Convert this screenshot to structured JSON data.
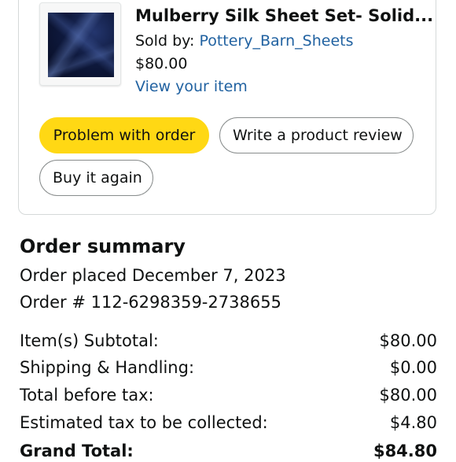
{
  "item": {
    "title": "Mulberry Silk Sheet Set- Solid...",
    "sold_by_label": "Sold by: ",
    "seller": "Pottery_Barn_Sheets",
    "price": "$80.00",
    "view_link": "View your item"
  },
  "actions": {
    "problem": "Problem with order",
    "review": "Write a product review",
    "buy_again": "Buy it again"
  },
  "summary": {
    "heading": "Order summary",
    "placed": "Order placed December 7, 2023",
    "order_number": "Order # 112-6298359-2738655",
    "lines": [
      {
        "label": "Item(s) Subtotal:",
        "value": "$80.00"
      },
      {
        "label": "Shipping & Handling:",
        "value": "$0.00"
      },
      {
        "label": "Total before tax:",
        "value": "$80.00"
      },
      {
        "label": "Estimated tax to be collected:",
        "value": "$4.80"
      },
      {
        "label": "Grand Total:",
        "value": "$84.80"
      }
    ]
  },
  "colors": {
    "accent_yellow": "#ffd814",
    "link_blue": "#2162a1",
    "text": "#0f1111",
    "border": "#d5d9d9"
  }
}
